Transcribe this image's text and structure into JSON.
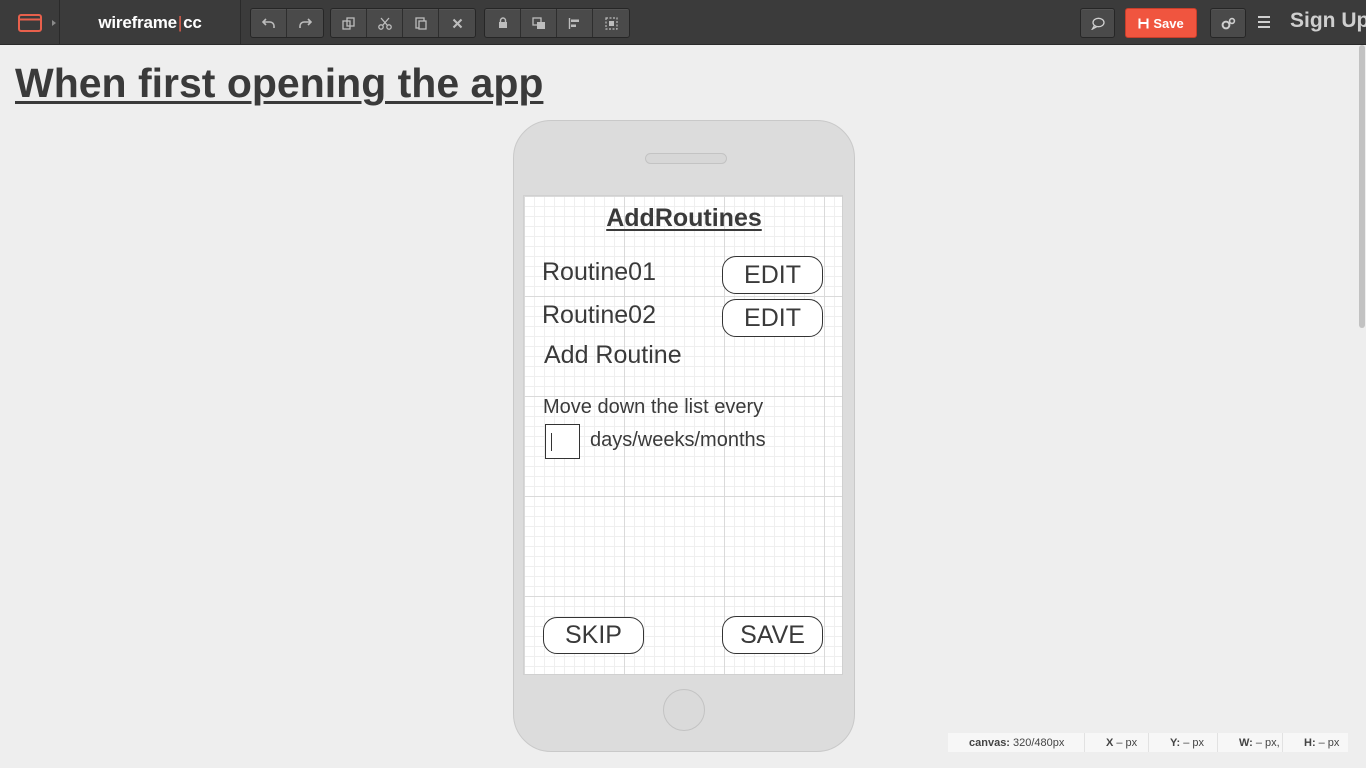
{
  "toolbar": {
    "brand_left": "wireframe",
    "brand_sep": "|",
    "brand_right": "cc",
    "save_label": "Save",
    "signup_label": "Sign Up",
    "accent_color": "#f0553f",
    "icons": [
      "window-icon",
      "undo-icon",
      "redo-icon",
      "duplicate-icon",
      "cut-icon",
      "paste-icon",
      "delete-icon",
      "lock-icon",
      "arrange-icon",
      "align-icon",
      "group-icon",
      "comment-icon",
      "save-icon",
      "settings-icon",
      "menu-icon"
    ]
  },
  "page": {
    "title": "When first opening the app"
  },
  "screen": {
    "title": "AddRoutines",
    "routines": [
      {
        "label": "Routine01",
        "action": "EDIT"
      },
      {
        "label": "Routine02",
        "action": "EDIT"
      }
    ],
    "add_routine": "Add Routine",
    "move_text": "Move down the list every",
    "interval_text": "days/weeks/months",
    "skip_label": "SKIP",
    "save_label": "SAVE"
  },
  "status": {
    "canvas_label": "canvas:",
    "canvas_value": "320/480px",
    "x_label": "X",
    "x_value": "– px",
    "y_label": "Y:",
    "y_value": "– px",
    "w_label": "W:",
    "w_value": "– px,",
    "h_label": "H:",
    "h_value": "– px"
  }
}
